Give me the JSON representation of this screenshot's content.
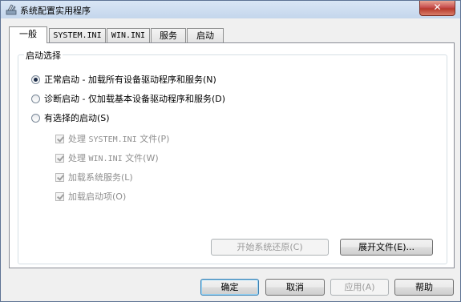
{
  "window": {
    "title": "系统配置实用程序",
    "close_glyph": "✕"
  },
  "tabs": [
    {
      "label": "一般"
    },
    {
      "label": "SYSTEM.INI"
    },
    {
      "label": "WIN.INI"
    },
    {
      "label": "服务"
    },
    {
      "label": "启动"
    }
  ],
  "startup": {
    "legend": "启动选择",
    "options": [
      {
        "label": "正常启动 - 加载所有设备驱动程序和服务(N)",
        "selected": true
      },
      {
        "label": "诊断启动 - 仅加载基本设备驱动程序和服务(D)",
        "selected": false
      },
      {
        "label": "有选择的启动(S)",
        "selected": false
      }
    ],
    "selective": {
      "system_ini": {
        "prefix": "处理 ",
        "file": "SYSTEM.INI",
        "suffix": " 文件(P)",
        "checked": true
      },
      "win_ini": {
        "prefix": "处理 ",
        "file": "WIN.INI",
        "suffix": " 文件(W)",
        "checked": true
      },
      "services": {
        "label": "加载系统服务(L)",
        "checked": true
      },
      "startup_items": {
        "label": "加载启动项(O)",
        "checked": true
      }
    },
    "restore_button": "开始系统还原(C)",
    "expand_button": "展开文件(E)..."
  },
  "footer": {
    "ok": "确定",
    "cancel": "取消",
    "apply": "应用(A)",
    "help": "帮助"
  }
}
